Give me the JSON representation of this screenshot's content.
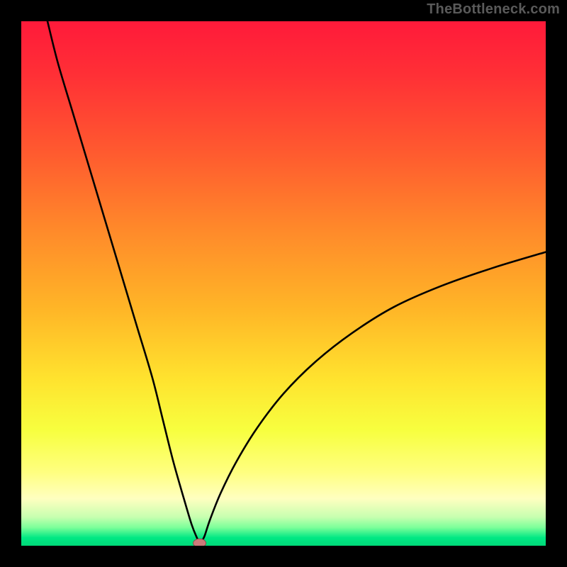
{
  "watermark": "TheBottleneck.com",
  "colors": {
    "frame": "#000000",
    "curve": "#000000",
    "gradient_stops": [
      {
        "offset": 0.0,
        "color": "#ff1a3a"
      },
      {
        "offset": 0.1,
        "color": "#ff2f36"
      },
      {
        "offset": 0.25,
        "color": "#ff5a2f"
      },
      {
        "offset": 0.4,
        "color": "#ff8a2a"
      },
      {
        "offset": 0.55,
        "color": "#ffb627"
      },
      {
        "offset": 0.68,
        "color": "#ffe22e"
      },
      {
        "offset": 0.78,
        "color": "#f7ff3f"
      },
      {
        "offset": 0.86,
        "color": "#ffff80"
      },
      {
        "offset": 0.91,
        "color": "#ffffc0"
      },
      {
        "offset": 0.945,
        "color": "#c8ffb0"
      },
      {
        "offset": 0.965,
        "color": "#7dff9a"
      },
      {
        "offset": 0.985,
        "color": "#00e884"
      },
      {
        "offset": 1.0,
        "color": "#00d878"
      }
    ],
    "marker_fill": "#cc7a7a",
    "marker_stroke": "#8c4f4f"
  },
  "chart_data": {
    "type": "line",
    "title": "",
    "xlabel": "",
    "ylabel": "",
    "xlim": [
      0,
      100
    ],
    "ylim": [
      0,
      100
    ],
    "grid": false,
    "legend": false,
    "series": [
      {
        "name": "bottleneck-curve",
        "x": [
          5,
          7,
          10,
          13,
          16,
          19,
          22,
          25,
          27,
          29,
          31,
          32.5,
          33.5,
          34,
          34.5,
          35,
          36,
          38,
          41,
          45,
          50,
          56,
          63,
          71,
          80,
          90,
          100
        ],
        "y": [
          100,
          92,
          82,
          72,
          62,
          52,
          42,
          32,
          24,
          16,
          9,
          4,
          1.5,
          0.5,
          1,
          2,
          5,
          10,
          16,
          22.5,
          29,
          35,
          40.5,
          45.5,
          49.5,
          53,
          56
        ]
      }
    ],
    "annotations": [
      {
        "name": "optimal-marker",
        "x": 34,
        "y": 0.5
      }
    ]
  }
}
